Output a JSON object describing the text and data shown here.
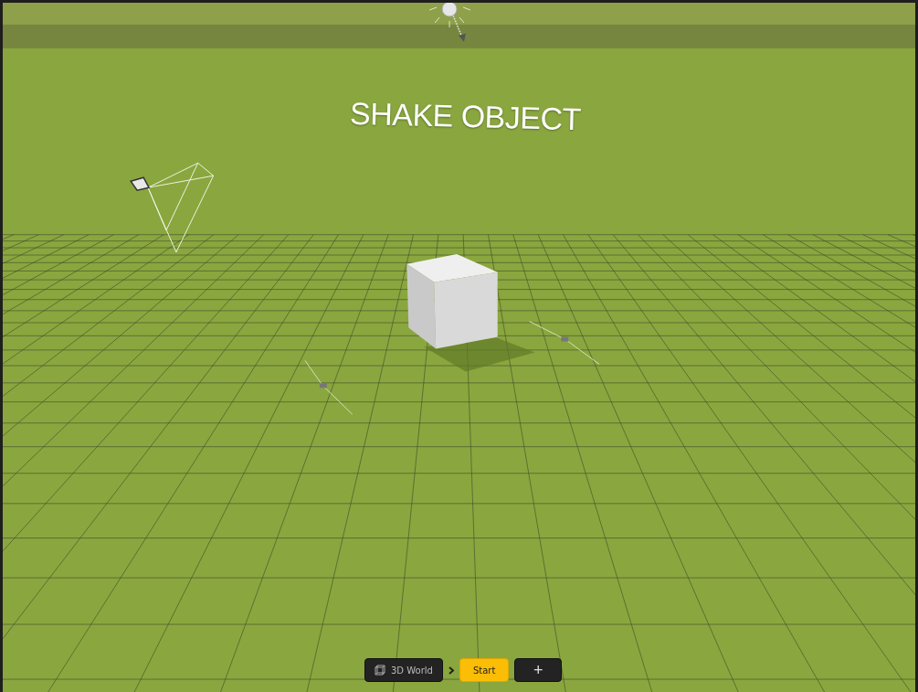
{
  "scene": {
    "title": "SHAKE OBJECT"
  },
  "breadcrumb": [
    {
      "label": "3D World",
      "kind": "scene",
      "selected": false
    },
    {
      "label": "Start",
      "kind": "node",
      "selected": true
    }
  ],
  "add_button": {
    "label": "+"
  }
}
